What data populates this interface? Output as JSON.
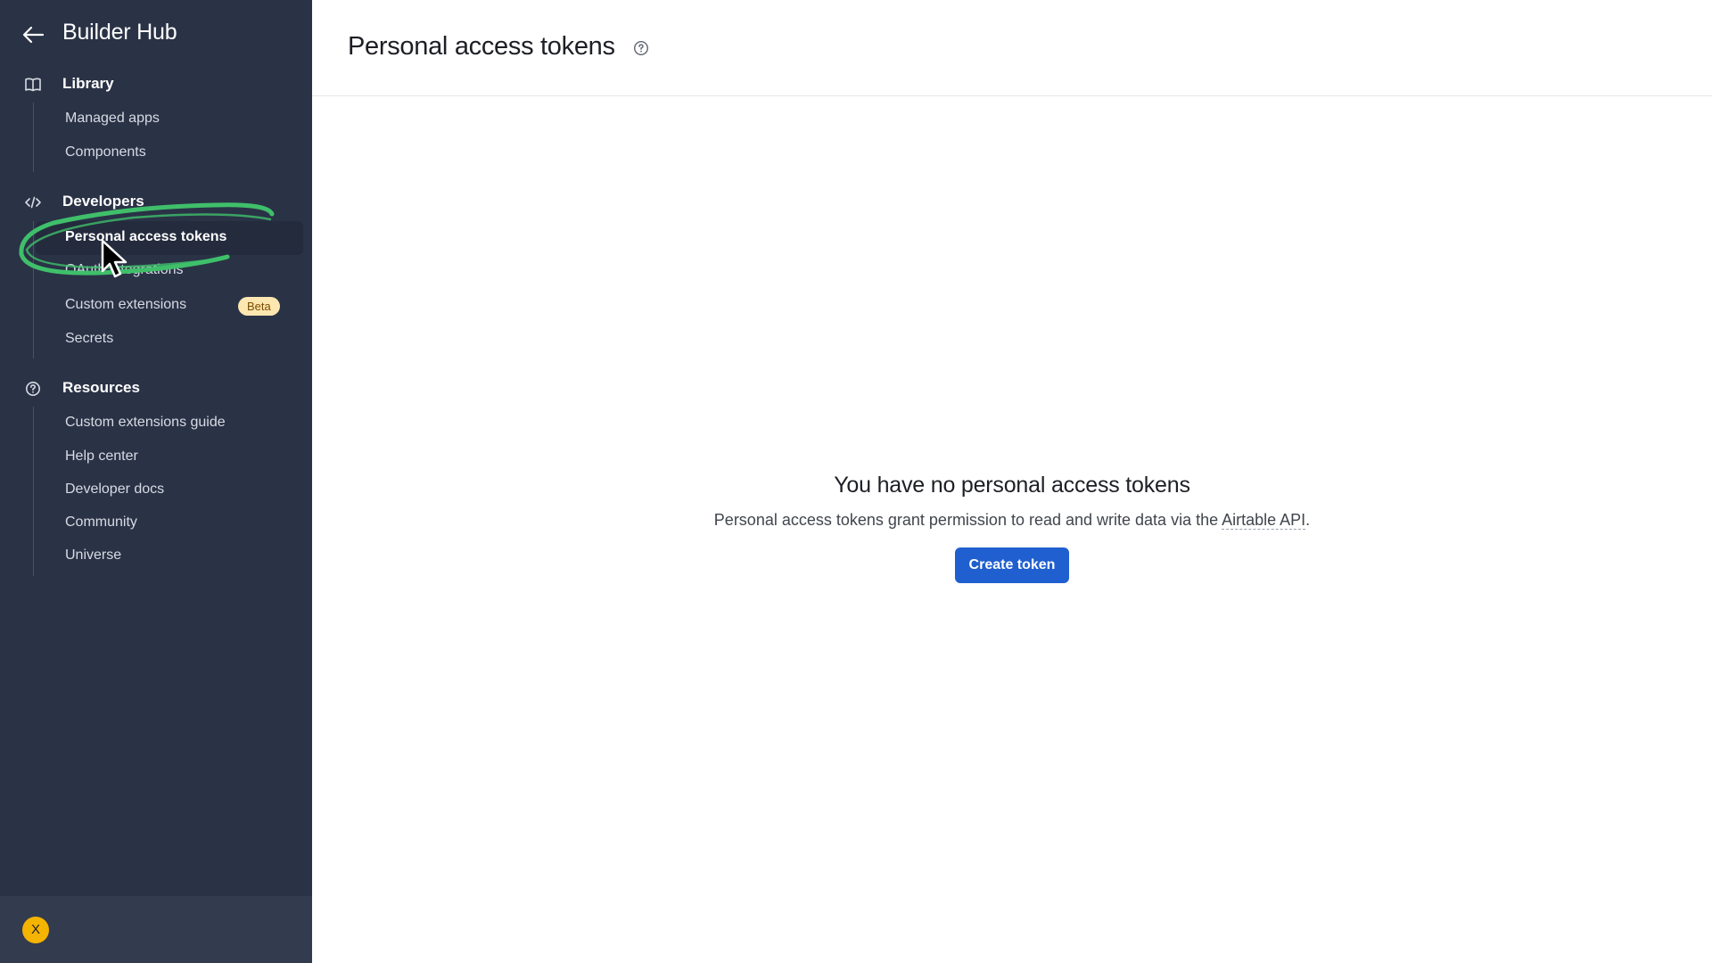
{
  "sidebar": {
    "title": "Builder Hub",
    "sections": [
      {
        "label": "Library",
        "icon": "book-icon",
        "items": [
          {
            "label": "Managed apps"
          },
          {
            "label": "Components"
          }
        ]
      },
      {
        "label": "Developers",
        "icon": "code-icon",
        "items": [
          {
            "label": "Personal access tokens",
            "active": true
          },
          {
            "label": "OAuth integrations"
          },
          {
            "label": "Custom extensions",
            "badge": "Beta"
          },
          {
            "label": "Secrets"
          }
        ]
      },
      {
        "label": "Resources",
        "icon": "question-circle-icon",
        "items": [
          {
            "label": "Custom extensions guide"
          },
          {
            "label": "Help center"
          },
          {
            "label": "Developer docs"
          },
          {
            "label": "Community"
          },
          {
            "label": "Universe"
          }
        ]
      }
    ],
    "user": {
      "avatar_initial": "X",
      "avatar_color": "#f5b400"
    }
  },
  "main": {
    "title": "Personal access tokens",
    "empty_state": {
      "title": "You have no personal access tokens",
      "description_prefix": "Personal access tokens grant permission to read and write data via the ",
      "link_text": "Airtable API",
      "description_suffix": ".",
      "button_label": "Create token"
    }
  },
  "colors": {
    "sidebar_bg": "#2a3246",
    "primary_button": "#1f5fcf",
    "beta_badge_bg": "#fde7b0",
    "annotation_stroke": "#3fbf6a"
  }
}
